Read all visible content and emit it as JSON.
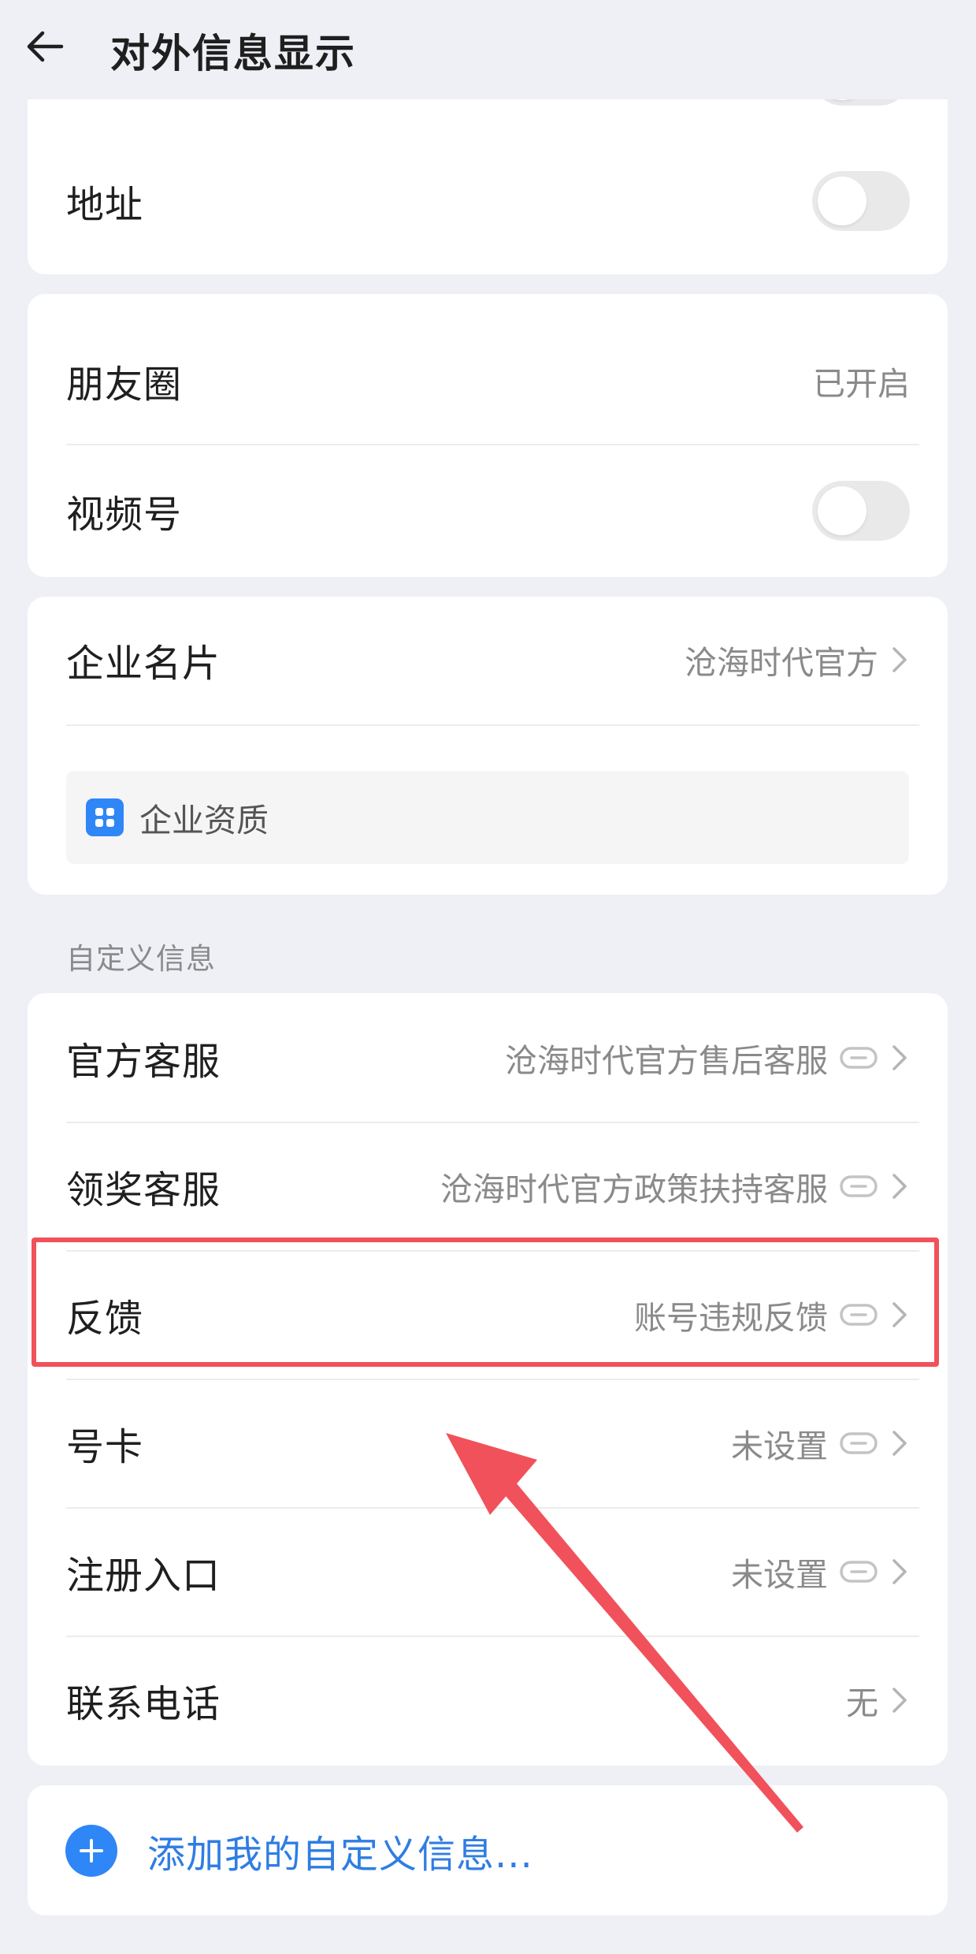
{
  "header": {
    "title": "对外信息显示",
    "back_icon": "arrow-left-icon"
  },
  "card1": {
    "address_label": "地址",
    "address_toggle_on": false
  },
  "card2": {
    "moments_label": "朋友圈",
    "moments_value": "已开启",
    "channels_label": "视频号",
    "channels_toggle_on": false
  },
  "card3": {
    "biz_card_label": "企业名片",
    "biz_card_value": "沧海时代官方",
    "qualification_label": "企业资质"
  },
  "custom_section_label": "自定义信息",
  "custom_items": [
    {
      "label": "官方客服",
      "value": "沧海时代官方售后客服",
      "has_link": true
    },
    {
      "label": "领奖客服",
      "value": "沧海时代官方政策扶持客服",
      "has_link": true
    },
    {
      "label": "反馈",
      "value": "账号违规反馈",
      "has_link": true
    },
    {
      "label": "号卡",
      "value": "未设置",
      "has_link": true
    },
    {
      "label": "注册入口",
      "value": "未设置",
      "has_link": true
    },
    {
      "label": "联系电话",
      "value": "无",
      "has_link": false
    }
  ],
  "add_custom_label": "添加我的自定义信息...",
  "colors": {
    "accent_blue": "#2f86f6",
    "link_text_blue": "#2f7de3",
    "annotation_red": "#f1515a",
    "background": "#eef0f5"
  }
}
